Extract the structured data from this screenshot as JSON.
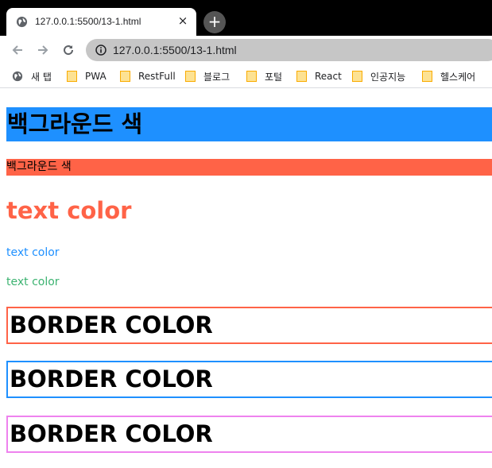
{
  "browser": {
    "tab_title": "127.0.0.1:5500/13-1.html",
    "tab_close": "×",
    "new_tab": "+",
    "url": "127.0.0.1:5500/13-1.html",
    "bookmarks": [
      {
        "label": "새 탭",
        "icon": "globe-icon"
      },
      {
        "label": "PWA",
        "icon": "folder-icon"
      },
      {
        "label": "RestFull",
        "icon": "folder-icon"
      },
      {
        "label": "블로그",
        "icon": "folder-icon"
      },
      {
        "label": "포털",
        "icon": "folder-icon"
      },
      {
        "label": "React",
        "icon": "folder-icon"
      },
      {
        "label": "인공지능",
        "icon": "folder-icon"
      },
      {
        "label": "헬스케어",
        "icon": "folder-icon"
      }
    ]
  },
  "page": {
    "heading_bg": "백그라운드 색",
    "para_bg": "백그라운드 색",
    "heading_color": "text color",
    "para_blue": "text color",
    "para_green": "text color",
    "border_headings": [
      "BORDER COLOR",
      "BORDER COLOR",
      "BORDER COLOR"
    ]
  },
  "colors": {
    "dodgerblue": "#1e90ff",
    "tomato": "#ff6347",
    "mediumseagreen": "#3cb371",
    "violet": "#ee82ee"
  }
}
